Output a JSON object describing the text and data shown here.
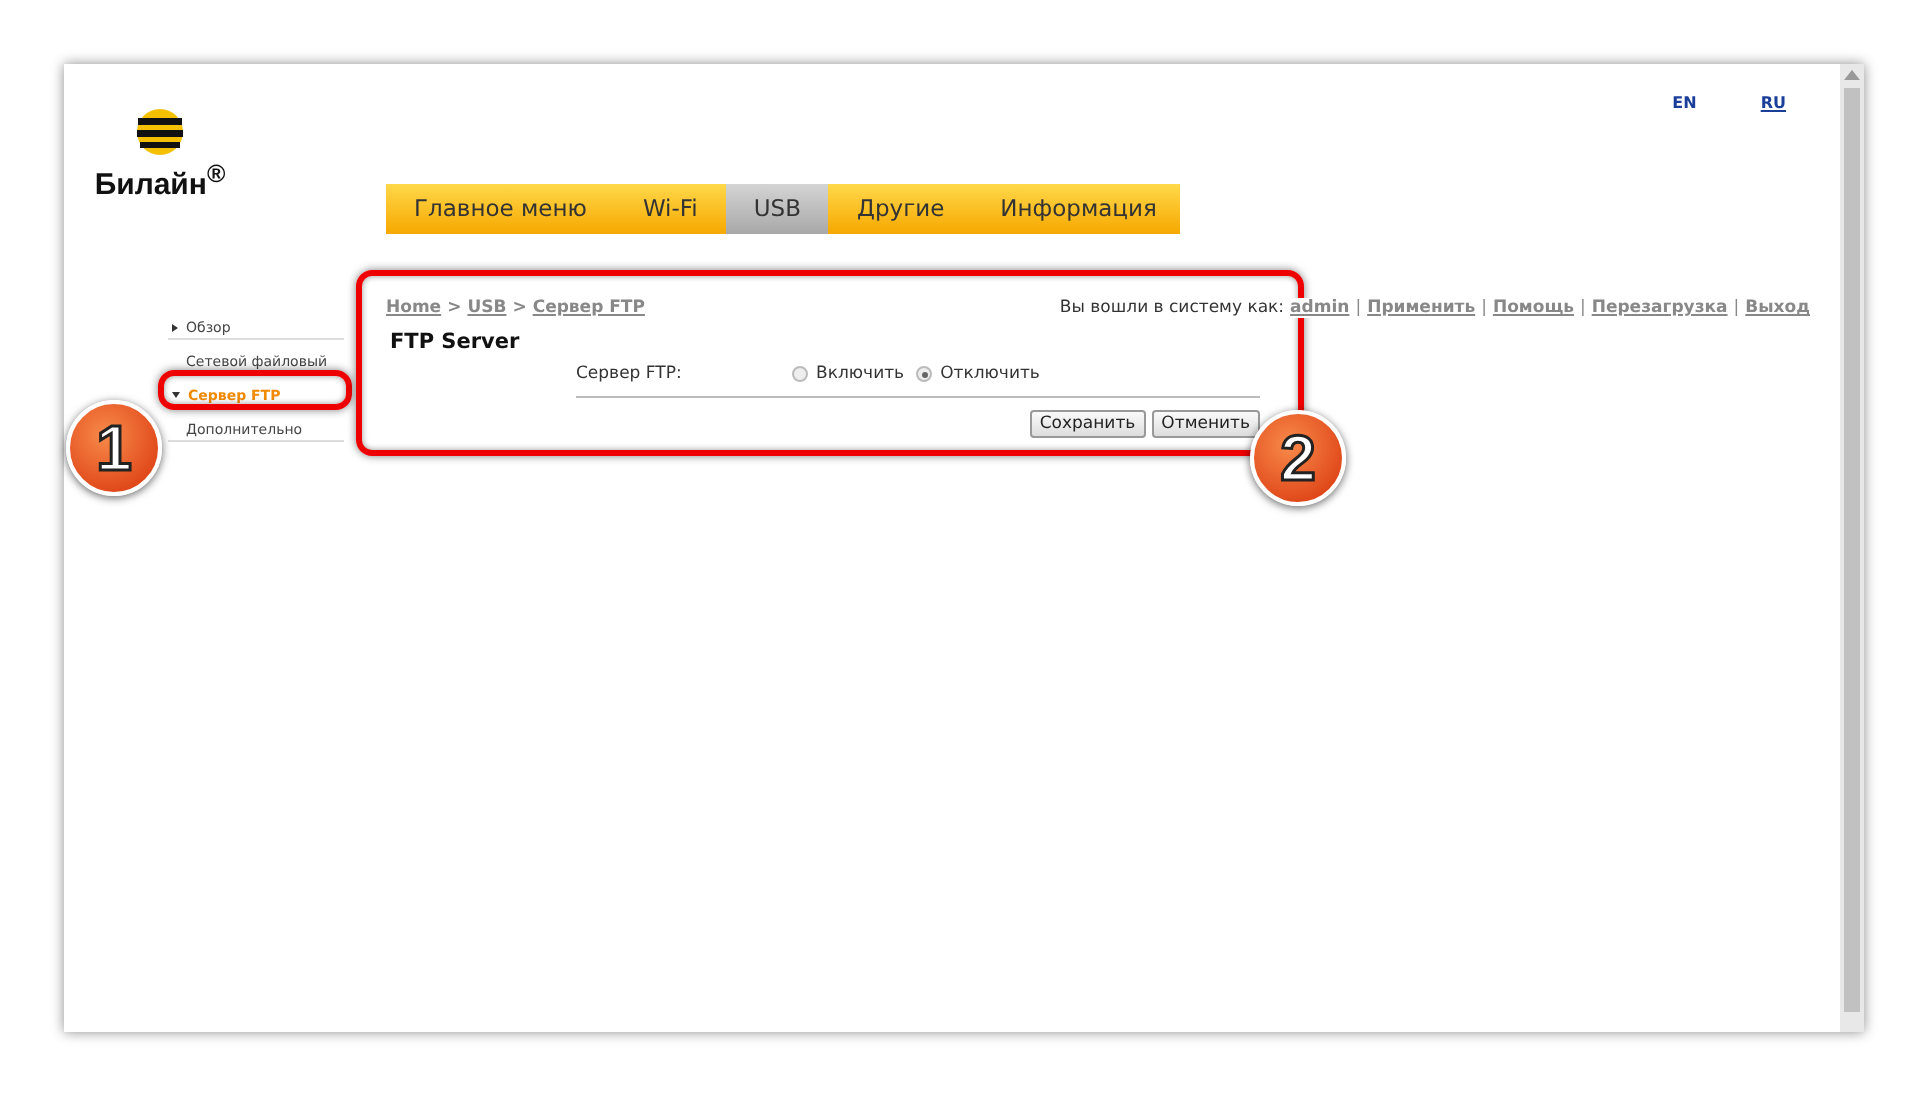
{
  "logo": {
    "text": "Билайн$^{®}$"
  },
  "languages": [
    {
      "label": "EN",
      "selected": true
    },
    {
      "label": "RU",
      "selected": false
    }
  ],
  "nav": [
    {
      "label": "Главное меню",
      "selected": false
    },
    {
      "label": "Wi-Fi",
      "selected": false
    },
    {
      "label": "USB",
      "selected": true
    },
    {
      "label": "Другие",
      "selected": false
    },
    {
      "label": "Информация",
      "selected": false
    }
  ],
  "sidebar": {
    "items": [
      {
        "label": "Обзор",
        "kind": "collapsed",
        "selected": false
      },
      {
        "label": "Сетевой файловый",
        "kind": "leaf",
        "selected": false
      },
      {
        "label": "Сервер FTP",
        "kind": "expanded",
        "selected": true
      },
      {
        "label": "Дополнительно",
        "kind": "leaf",
        "selected": false
      }
    ]
  },
  "breadcrumb": [
    {
      "text": "Home",
      "kind": "link"
    },
    {
      "text": ">",
      "kind": "separator"
    },
    {
      "text": "USB",
      "kind": "link"
    },
    {
      "text": ">",
      "kind": "separator"
    },
    {
      "text": "Сервер FTP",
      "kind": "link"
    }
  ],
  "login": [
    {
      "text": "Вы вошли в систему как:",
      "kind": "text"
    },
    {
      "text": "admin",
      "kind": "link"
    },
    {
      "text": "|",
      "kind": "separator"
    },
    {
      "text": "Применить",
      "kind": "link"
    },
    {
      "text": "|",
      "kind": "separator"
    },
    {
      "text": "Помощь",
      "kind": "link"
    },
    {
      "text": "|",
      "kind": "separator"
    },
    {
      "text": "Перезагрузка",
      "kind": "link"
    },
    {
      "text": "|",
      "kind": "separator"
    },
    {
      "text": "Выход",
      "kind": "link"
    }
  ],
  "page_title": "FTP Server",
  "form": {
    "label": "Сервер FTP:",
    "options": [
      {
        "label": "Включить",
        "selected": false
      },
      {
        "label": "Отключить",
        "selected": true
      }
    ]
  },
  "buttons": [
    "Сохранить",
    "Отменить"
  ],
  "callouts": [
    {
      "number": "1"
    },
    {
      "number": "2"
    }
  ]
}
